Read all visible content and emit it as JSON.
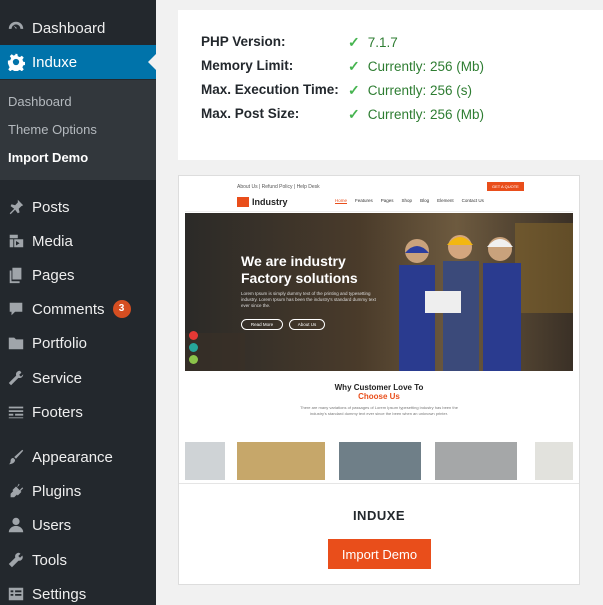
{
  "sidebar": {
    "top_items": [
      {
        "label": "Dashboard",
        "icon": "dashboard-icon"
      },
      {
        "label": "Induxe",
        "icon": "gear-icon"
      }
    ],
    "submenu": [
      "Dashboard",
      "Theme Options",
      "Import Demo"
    ],
    "items": [
      {
        "label": "Posts",
        "icon": "pin-icon"
      },
      {
        "label": "Media",
        "icon": "media-icon"
      },
      {
        "label": "Pages",
        "icon": "pages-icon"
      },
      {
        "label": "Comments",
        "icon": "comment-icon",
        "badge": "3"
      },
      {
        "label": "Portfolio",
        "icon": "folder-icon"
      },
      {
        "label": "Service",
        "icon": "wrench-icon"
      },
      {
        "label": "Footers",
        "icon": "footer-icon"
      },
      {
        "label": "Appearance",
        "icon": "brush-icon"
      },
      {
        "label": "Plugins",
        "icon": "plugin-icon"
      },
      {
        "label": "Users",
        "icon": "user-icon"
      },
      {
        "label": "Tools",
        "icon": "tools-icon"
      },
      {
        "label": "Settings",
        "icon": "settings-icon"
      }
    ]
  },
  "requirements": [
    {
      "label": "PHP Version:",
      "value": "7.1.7"
    },
    {
      "label": "Memory Limit:",
      "value": "Currently: 256 (Mb)"
    },
    {
      "label": "Max. Execution Time:",
      "value": "Currently: 256 (s)"
    },
    {
      "label": "Max. Post Size:",
      "value": "Currently: 256 (Mb)"
    }
  ],
  "demo": {
    "theme_name": "INDUXE",
    "button_label": "Import Demo",
    "preview": {
      "topbar_links": "About Us  |  Refund Policy  |  Help Desk",
      "quote_button": "GET A QUOTE",
      "logo_text": "Industry",
      "nav": [
        "Home",
        "Features",
        "Pages",
        "Shop",
        "Blog",
        "Element",
        "Contact Us"
      ],
      "hero_title_1": "We are industry",
      "hero_title_2": "Factory solutions",
      "hero_text": "Lorem Ipsum is simply dummy text of the printing and typesetting industry. Lorem Ipsum has been the industry's standard dummy text ever since the.",
      "btn_read_more": "Read More",
      "btn_about": "About Us",
      "why_title": "Why Customer Love To",
      "why_sub": "Choose Us",
      "why_text": "There are many variations of passages of Lorem Ipsum typesetting industry has been the industry's standard dummy text ever since the been when an unknown printer."
    }
  },
  "colors": {
    "sidebar_bg": "#23282d",
    "active_bg": "#0073aa",
    "badge": "#d54e21",
    "check": "#46b450",
    "accent": "#e94e1b"
  }
}
